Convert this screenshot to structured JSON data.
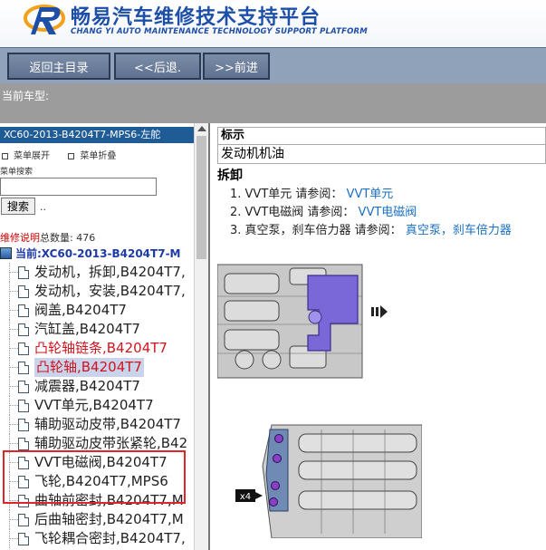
{
  "header": {
    "title": "畅易汽车维修技术支持平台",
    "subtitle": "CHANG YI AUTO MAINTENANCE TECHNOLOGY SUPPORT PLATFORM"
  },
  "toolbar": {
    "home_label": "返回主目录",
    "back_label": "<<后退.",
    "forward_label": ">>前进"
  },
  "current_vehicle_label": "当前车型:",
  "sidebar": {
    "model": "XC60-2013-B4204T7-MPS6-左舵",
    "expand_label": "菜单展开",
    "collapse_label": "菜单折叠",
    "search_label": "菜单搜索",
    "search_value": "",
    "search_button": "搜索",
    "search_dots": "..",
    "total_link": "维修说明",
    "total_label": "总数量:",
    "total_value": "476",
    "current_label": "当前:XC60-2013-B4204T7-M",
    "items": [
      {
        "label": "发动机，拆卸,B4204T7,"
      },
      {
        "label": "发动机，安装,B4204T7,"
      },
      {
        "label": "阀盖,B4204T7"
      },
      {
        "label": "汽缸盖,B4204T7"
      },
      {
        "label": "凸轮轴链条,B4204T7"
      },
      {
        "label": "凸轮轴,B4204T7"
      },
      {
        "label": "减震器,B4204T7"
      },
      {
        "label": "VVT单元,B4204T7"
      },
      {
        "label": "辅助驱动皮带,B4204T7"
      },
      {
        "label": "辅助驱动皮带张紧轮,B42"
      },
      {
        "label": "VVT电磁阀,B4204T7"
      },
      {
        "label": "飞轮,B4204T7,MPS6"
      },
      {
        "label": "曲轴前密封,B4204T7,M"
      },
      {
        "label": "后曲轴密封,B4204T7,M"
      },
      {
        "label": "飞轮耦合密封,B4204T7,"
      }
    ]
  },
  "content": {
    "header_label": "标示",
    "header_value": "发动机机油",
    "section_title": "拆卸",
    "steps": [
      {
        "prefix": "1. VVT单元 请参阅：",
        "link": "VVT单元"
      },
      {
        "prefix": "2. VVT电磁阀 请参阅：",
        "link": "VVT电磁阀"
      },
      {
        "prefix": "3. 真空泵，刹车倍力器 请参阅：",
        "link": "真空泵，刹车倍力器"
      }
    ],
    "figure2_callout": "x4"
  },
  "colors": {
    "brand_blue": "#1e4fa8",
    "toolbar": "#8fa2b9",
    "model_bar": "#1f5c96",
    "highlight_red": "#d0141e",
    "link_blue": "#1a6fc0",
    "figure_purple": "#7b68d8"
  }
}
